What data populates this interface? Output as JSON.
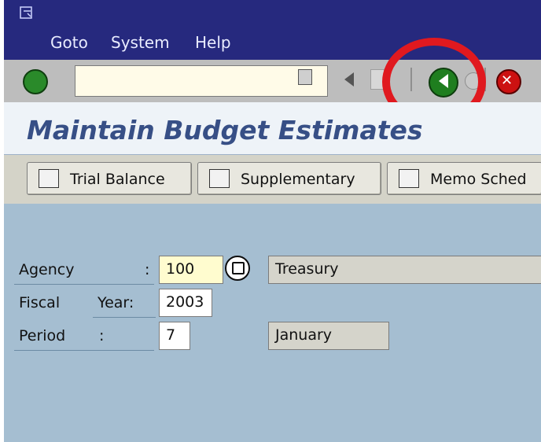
{
  "menu": {
    "goto": "Goto",
    "system": "System",
    "help": "Help"
  },
  "toolbar": {
    "command_field_value": "",
    "back_button_label": "",
    "exit_button_label": "",
    "cancel_button_label": ""
  },
  "title": "Maintain Budget Estimates",
  "app_toolbar": {
    "trial_balance": "Trial Balance",
    "supplementary": "Supplementary",
    "memo_schedule": "Memo Sched"
  },
  "form": {
    "agency_label": "Agency",
    "agency_colon": ":",
    "agency_value": "100",
    "agency_description": "Treasury",
    "fiscal_label": "Fiscal",
    "year_label": "Year:",
    "fiscal_year_value": "2003",
    "period_label": "Period",
    "period_colon": ":",
    "period_value": "7",
    "period_description": "January"
  },
  "colors": {
    "menu_bg": "#26297e",
    "title_text": "#374f86",
    "content_bg": "#a5bed1",
    "annotation_red": "#e0191f"
  },
  "icons": {
    "check": "check-icon",
    "back": "back-arrow-icon",
    "cancel": "cancel-x-icon",
    "help": "possible-entries-icon"
  }
}
